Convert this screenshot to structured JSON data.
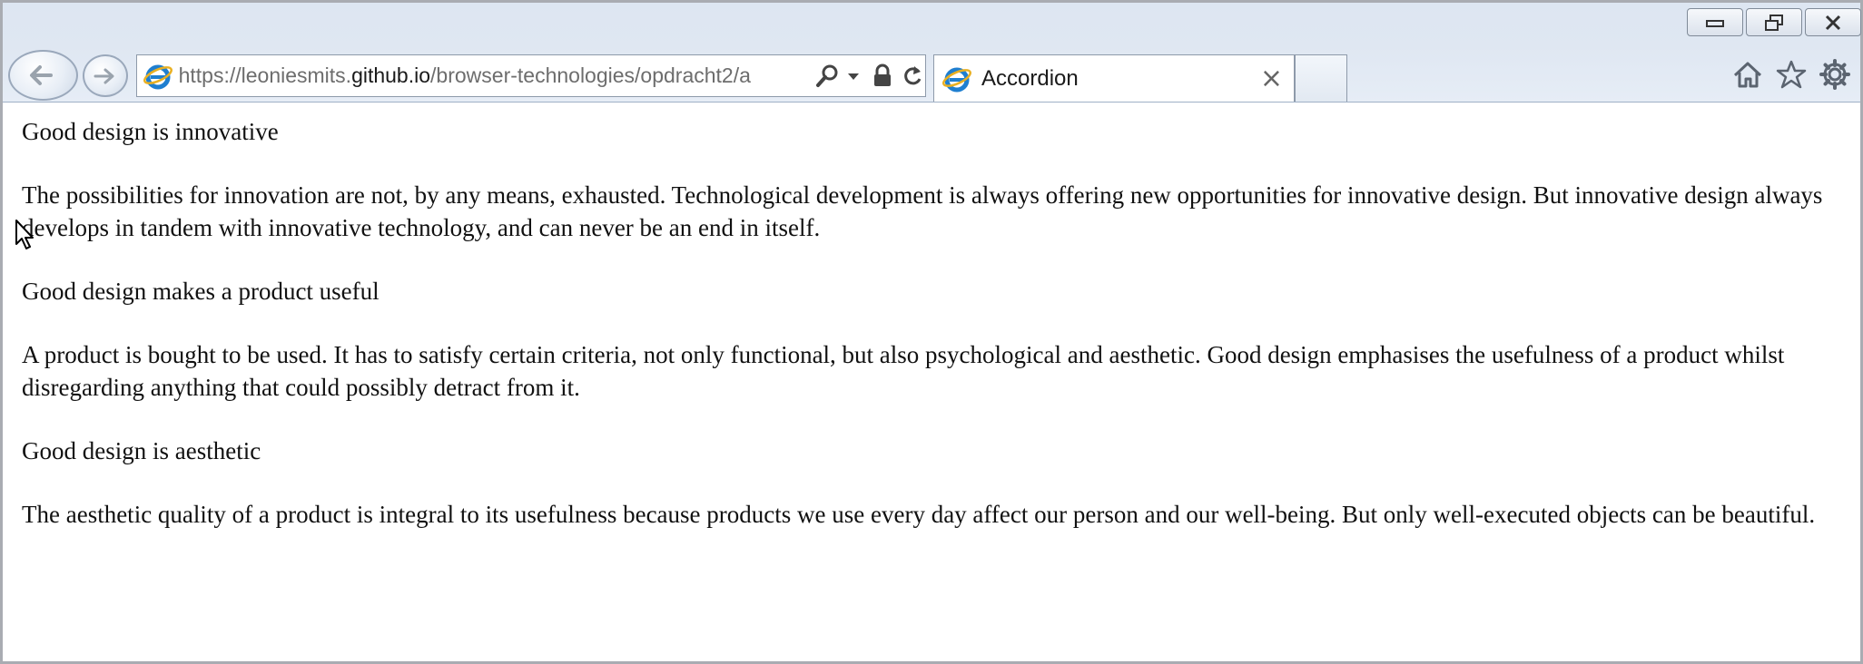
{
  "browser": {
    "url_prefix": "https://leoniesmits.",
    "url_domain": "github.io",
    "url_path": "/browser-technologies/opdracht2/a",
    "tab_title": "Accordion",
    "tab_close": "×"
  },
  "page": {
    "sections": [
      {
        "heading": "Good design is innovative",
        "body": "The possibilities for innovation are not, by any means, exhausted. Technological development is always offering new opportunities for innovative design. But innovative design always develops in tandem with innovative technology, and can never be an end in itself."
      },
      {
        "heading": "Good design makes a product useful",
        "body": "A product is bought to be used. It has to satisfy certain criteria, not only functional, but also psychological and aesthetic. Good design emphasises the usefulness of a product whilst disregarding anything that could possibly detract from it."
      },
      {
        "heading": "Good design is aesthetic",
        "body": "The aesthetic quality of a product is integral to its usefulness because products we use every day affect our person and our well-being. But only well-executed objects can be beautiful."
      }
    ]
  },
  "colors": {
    "chrome_bg": "#dfe7f2",
    "text": "#111111",
    "ie_blue": "#1f7fd0"
  }
}
